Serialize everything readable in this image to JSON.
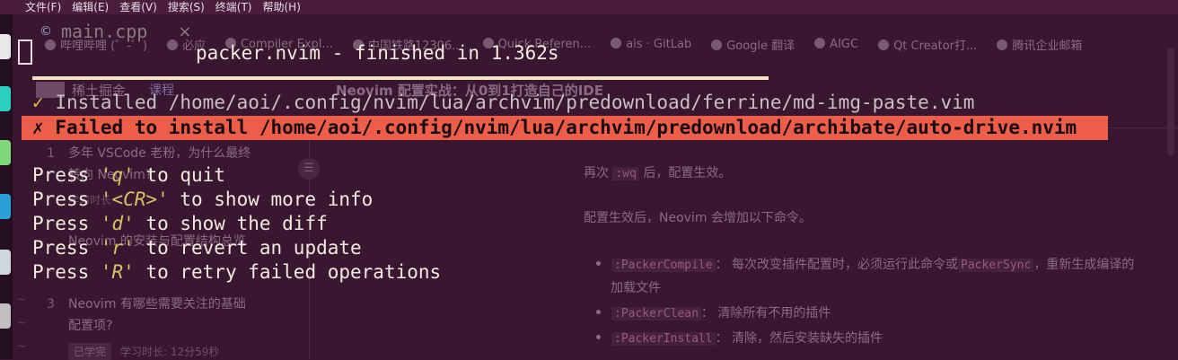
{
  "menubar": [
    "文件(F)",
    "编辑(E)",
    "查看(V)",
    "搜索(S)",
    "终端(T)",
    "帮助(H)"
  ],
  "editor_tab": {
    "name": "main.cpp",
    "close": "×"
  },
  "bookmarks": [
    "哔哩哔哩 (゜-゜)",
    "必应",
    "Compiler Expl...",
    "中国铁路12306...",
    "Quick Referen...",
    "ais · GitLab",
    "Google 翻译",
    "AIGC",
    "Qt Creator打...",
    "腾讯企业邮箱"
  ],
  "site": {
    "name": "稀土掘金",
    "course_tab": "课程",
    "article_title": "Neovim 配置实战：从0到1打造自己的IDE"
  },
  "sidebar": [
    {
      "num": "1",
      "lines": [
        "多年 VSCode 老粉，为什么最终",
        "转向 Neovim?"
      ]
    },
    {
      "num": "",
      "lines": [
        "Neovim 的安装与配置结构总览"
      ]
    },
    {
      "num": "3",
      "lines": [
        "Neovim 有哪些需要关注的基础",
        "配置项?"
      ]
    }
  ],
  "sidebar_meta": {
    "badge": "已学完",
    "time": "学习时长: 12分59秒",
    "partial": "学习时长"
  },
  "article": {
    "p1": {
      "pre": "再次",
      "code": ":wq",
      "post": "后，配置生效。"
    },
    "p2": "配置生效后，Neovim 会增加以下命令。",
    "items": [
      {
        "code": ":PackerCompile",
        "text": "： 每次改变插件配置时，必须运行此命令或",
        "code2": "PackerSync",
        "text2": "，重新生成编译的"
      },
      {
        "code": "",
        "text": "加载文件",
        "code2": "",
        "text2": ""
      },
      {
        "code": ":PackerClean",
        "text": "： 清除所有不用的插件",
        "code2": "",
        "text2": ""
      },
      {
        "code": ":PackerInstall",
        "text": "： 清除，然后安装缺失的插件",
        "code2": "",
        "text2": ""
      }
    ]
  },
  "terminal": {
    "title": "packer.nvim - finished in 1.362s",
    "ok_mark": "✓",
    "ok_text": "Installed /home/aoi/.config/nvim/lua/archvim/predownload/ferrine/md-img-paste.vim",
    "fail_mark": "✗",
    "fail_text": "Failed to install /home/aoi/.config/nvim/lua/archvim/predownload/archibate/auto-drive.nvim",
    "press": [
      {
        "pre": "Press ",
        "key": "'q'",
        "post": " to quit"
      },
      {
        "pre": "Press ",
        "key": "'<CR>'",
        "post": " to show more info"
      },
      {
        "pre": "Press ",
        "key": "'d'",
        "post": " to show the diff"
      },
      {
        "pre": "Press ",
        "key": "'r'",
        "post": " to revert an update"
      },
      {
        "pre": "Press ",
        "key": "'R'",
        "post": " to retry failed operations"
      }
    ]
  },
  "colors": {
    "background": "#3a1730",
    "fail_bg": "#ec5e48",
    "ok_mark": "#e3b64a",
    "key_text": "#d9c16a"
  }
}
